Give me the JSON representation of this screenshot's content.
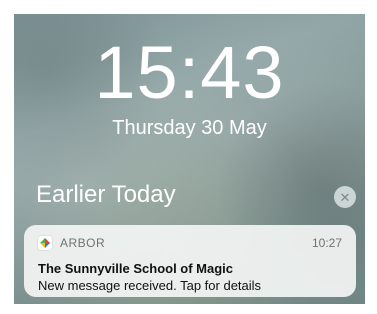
{
  "lockscreen": {
    "time": "15:43",
    "date": "Thursday 30 May",
    "section_title": "Earlier Today",
    "clear_icon": "close-icon"
  },
  "notification": {
    "app_icon": "arbor-logo-icon",
    "app_name": "ARBOR",
    "time": "10:27",
    "title": "The Sunnyville School of Magic",
    "body": "New message received. Tap for details"
  },
  "colors": {
    "arbor_red": "#e8413b",
    "arbor_green": "#4cb848",
    "arbor_yellow": "#f5b91e",
    "arbor_blue": "#2f7fc1"
  }
}
